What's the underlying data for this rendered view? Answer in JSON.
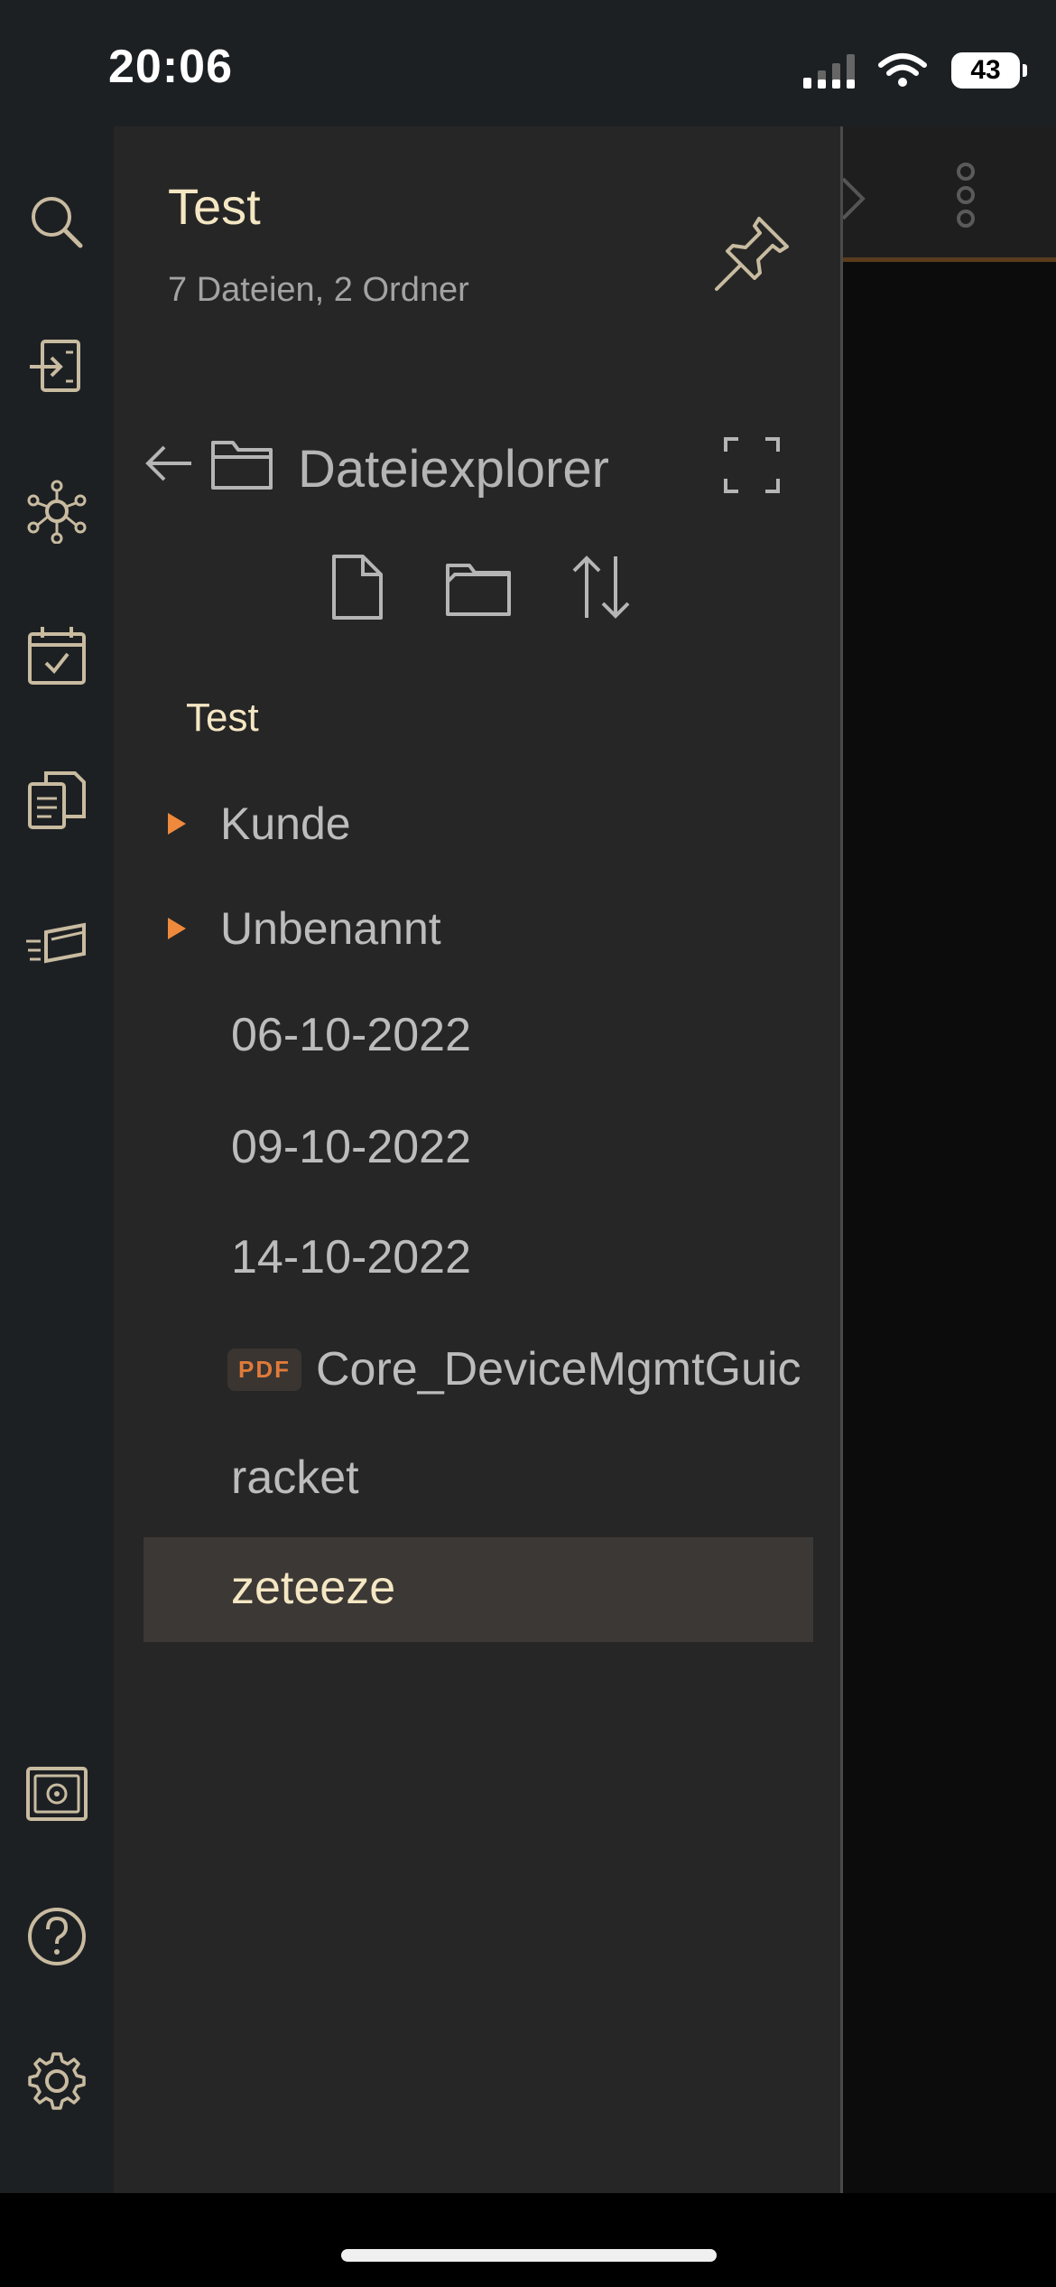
{
  "status_bar": {
    "time": "20:06",
    "battery": "43"
  },
  "rail": {
    "icons": [
      "search-icon",
      "import-icon",
      "graph-icon",
      "calendar-check-icon",
      "copy-document-icon",
      "cards-icon",
      "vault-icon",
      "help-icon",
      "settings-icon"
    ]
  },
  "drawer": {
    "vault_name": "Test",
    "vault_summary": "7 Dateien, 2 Ordner",
    "explorer_title": "Dateiexplorer",
    "tree_root": "Test",
    "folders": [
      {
        "label": "Kunde"
      },
      {
        "label": "Unbenannt"
      }
    ],
    "files": [
      {
        "label": "06-10-2022"
      },
      {
        "label": "09-10-2022"
      },
      {
        "label": "14-10-2022"
      }
    ],
    "pdf_file": {
      "badge": "PDF",
      "label": "Core_DeviceMgmtGuic"
    },
    "file_racket": "racket",
    "selected_file": "zeteeze"
  },
  "colors": {
    "accent": "#ef8a3c",
    "title_text": "#f4e7c3",
    "muted_text": "#bcbcbc",
    "drawer_bg": "#262626",
    "rail_bg": "#1d2023"
  }
}
